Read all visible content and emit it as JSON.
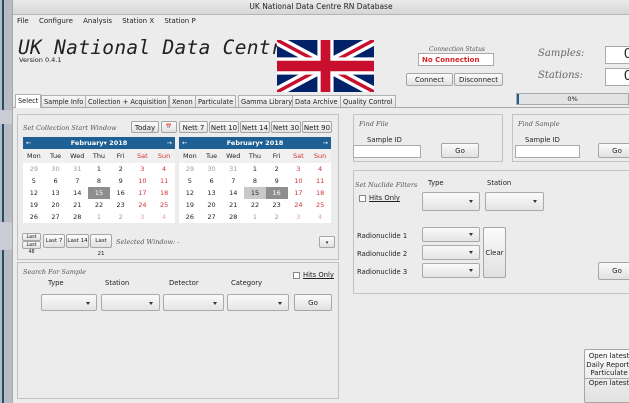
{
  "window_title": "UK National Data Centre RN Database",
  "menu": [
    "File",
    "Configure",
    "Analysis",
    "Station X",
    "Station P"
  ],
  "header": {
    "app_title": "UK National Data Centre",
    "version": "Version 0.4.1",
    "connection_status_label": "Connection Status",
    "connection_status_value": "No Connection",
    "connect_label": "Connect",
    "disconnect_label": "Disconnect",
    "samples_label": "Samples:",
    "samples_value": "0",
    "stations_label": "Stations:",
    "stations_value": "0"
  },
  "tabs": [
    "Select",
    "Sample Info",
    "Collection + Acquisition",
    "Xenon",
    "Particulate",
    "Gamma Library",
    "Data Archive",
    "Quality Control"
  ],
  "active_tab": "Select",
  "progress": {
    "text": "0%",
    "fraction": 0.0
  },
  "collection": {
    "label": "Set Collection Start Window",
    "today_label": "Today",
    "today_icon": "calendar-icon",
    "nett_buttons": [
      "Nett 7",
      "Nett 10",
      "Nett 14",
      "Nett 30",
      "Nett 90"
    ],
    "calendars": [
      {
        "month": "February",
        "year": "2018",
        "selected": "15",
        "weekdays": [
          "Mon",
          "Tue",
          "Wed",
          "Thu",
          "Fri",
          "Sat",
          "Sun"
        ],
        "weeks": [
          [
            "29",
            "30",
            "31",
            "1",
            "2",
            "3",
            "4"
          ],
          [
            "5",
            "6",
            "7",
            "8",
            "9",
            "10",
            "11"
          ],
          [
            "12",
            "13",
            "14",
            "15",
            "16",
            "17",
            "18"
          ],
          [
            "19",
            "20",
            "21",
            "22",
            "23",
            "24",
            "25"
          ],
          [
            "26",
            "27",
            "28",
            "1",
            "2",
            "3",
            "4"
          ]
        ]
      },
      {
        "month": "February",
        "year": "2018",
        "selected": "16",
        "weekdays": [
          "Mon",
          "Tue",
          "Wed",
          "Thu",
          "Fri",
          "Sat",
          "Sun"
        ],
        "weeks": [
          [
            "29",
            "30",
            "31",
            "1",
            "2",
            "3",
            "4"
          ],
          [
            "5",
            "6",
            "7",
            "8",
            "9",
            "10",
            "11"
          ],
          [
            "12",
            "13",
            "14",
            "15",
            "16",
            "17",
            "18"
          ],
          [
            "19",
            "20",
            "21",
            "22",
            "23",
            "24",
            "25"
          ],
          [
            "26",
            "27",
            "28",
            "1",
            "2",
            "3",
            "4"
          ]
        ]
      }
    ],
    "last_buttons": [
      "Last 24",
      "Last 48",
      "Last 7",
      "Last 14",
      "Last 21"
    ],
    "selected_window_label": "Selected Window: -"
  },
  "search_sample": {
    "label": "Search For Sample",
    "columns": [
      "Type",
      "Station",
      "Detector",
      "Category"
    ],
    "hits_only_label": "Hits Only",
    "go_label": "Go"
  },
  "find_file": {
    "label": "Find File",
    "sample_id_label": "Sample ID",
    "go_label": "Go"
  },
  "find_sample": {
    "label": "Find Sample",
    "sample_id_label": "Sample ID",
    "go_label": "Go"
  },
  "nuclide_filters": {
    "label": "Set Nuclide Filters",
    "type_label": "Type",
    "station_label": "Station",
    "hits_only_label": "Hits Only",
    "radionuclides": [
      "Radionuclide 1",
      "Radionuclide 2",
      "Radionuclide 3"
    ],
    "clear_label": "Clear",
    "go_label": "Go"
  },
  "report_button": [
    "Open latest",
    "Daily Report:",
    "Particulate",
    "Open latest"
  ]
}
